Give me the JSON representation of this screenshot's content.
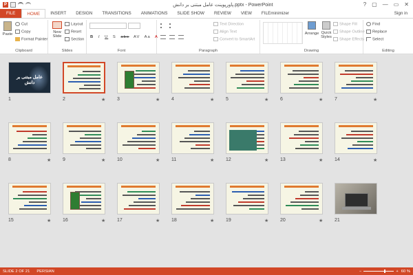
{
  "window": {
    "title": "پاورپوینت عامل مبتنی بر دانش.pptx - PowerPoint",
    "controls": [
      "?",
      "▢",
      "—",
      "▭",
      "✕"
    ]
  },
  "qat": {
    "app_letter": "P"
  },
  "tabs": [
    "FILE",
    "HOME",
    "INSERT",
    "DESIGN",
    "TRANSITIONS",
    "ANIMATIONS",
    "SLIDE SHOW",
    "REVIEW",
    "VIEW",
    "FILEminimizer"
  ],
  "signin": "Sign in",
  "ribbon": {
    "clipboard": {
      "label": "Clipboard",
      "paste": "Paste",
      "cut": "Cut",
      "copy": "Copy",
      "format_painter": "Format Painter"
    },
    "slides": {
      "label": "Slides",
      "new_slide": "New",
      "new_slide2": "Slide",
      "layout": "Layout",
      "reset": "Reset",
      "section": "Section"
    },
    "font": {
      "label": "Font",
      "styles": [
        "B",
        "I",
        "U",
        "S",
        "abc",
        "AV",
        "Aa",
        "A"
      ]
    },
    "paragraph": {
      "label": "Paragraph",
      "text_direction": "Text Direction",
      "align_text": "Align Text",
      "convert": "Convert to SmartArt"
    },
    "drawing": {
      "label": "Drawing",
      "arrange": "Arrange",
      "quick": "Quick",
      "styles": "Styles",
      "shape_fill": "Shape Fill",
      "shape_outline": "Shape Outline",
      "shape_effects": "Shape Effects"
    },
    "editing": {
      "label": "Editing",
      "find": "Find",
      "replace": "Replace",
      "select": "Select"
    }
  },
  "slides": {
    "cover_title": "عامل مبتنی بر دانش",
    "numbers": [
      "1",
      "2",
      "3",
      "4",
      "5",
      "6",
      "7",
      "8",
      "9",
      "10",
      "11",
      "12",
      "13",
      "14",
      "15",
      "16",
      "17",
      "18",
      "19",
      "20",
      "21"
    ],
    "star": "★"
  },
  "status": {
    "slide": "SLIDE 2 OF 21",
    "language": "PERSIAN",
    "zoom": "60 %"
  }
}
